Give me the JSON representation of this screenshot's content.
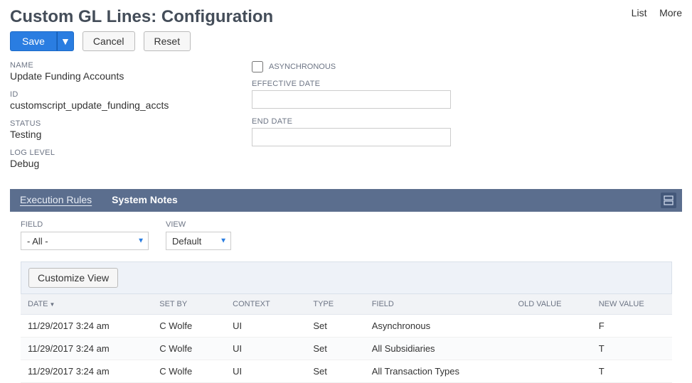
{
  "header": {
    "title": "Custom GL Lines: Configuration",
    "links": {
      "list": "List",
      "more": "More"
    }
  },
  "buttons": {
    "save": "Save",
    "cancel": "Cancel",
    "reset": "Reset",
    "customize_view": "Customize View"
  },
  "fields": {
    "name": {
      "label": "NAME",
      "value": "Update Funding Accounts"
    },
    "id": {
      "label": "ID",
      "value": "customscript_update_funding_accts"
    },
    "status": {
      "label": "STATUS",
      "value": "Testing"
    },
    "loglevel": {
      "label": "LOG LEVEL",
      "value": "Debug"
    },
    "asynchronous": {
      "label": "ASYNCHRONOUS",
      "checked": false
    },
    "effective_date": {
      "label": "EFFECTIVE DATE",
      "value": ""
    },
    "end_date": {
      "label": "END DATE",
      "value": ""
    }
  },
  "tabs": {
    "execution_rules": "Execution Rules",
    "system_notes": "System Notes"
  },
  "filters": {
    "field": {
      "label": "FIELD",
      "value": "- All -"
    },
    "view": {
      "label": "VIEW",
      "value": "Default"
    }
  },
  "table": {
    "columns": {
      "date": "DATE",
      "set_by": "SET BY",
      "context": "CONTEXT",
      "type": "TYPE",
      "field": "FIELD",
      "old_value": "OLD VALUE",
      "new_value": "NEW VALUE"
    },
    "rows": [
      {
        "date": "11/29/2017 3:24 am",
        "set_by": "C Wolfe",
        "context": "UI",
        "type": "Set",
        "field": "Asynchronous",
        "old_value": "",
        "new_value": "F"
      },
      {
        "date": "11/29/2017 3:24 am",
        "set_by": "C Wolfe",
        "context": "UI",
        "type": "Set",
        "field": "All Subsidiaries",
        "old_value": "",
        "new_value": "T"
      },
      {
        "date": "11/29/2017 3:24 am",
        "set_by": "C Wolfe",
        "context": "UI",
        "type": "Set",
        "field": "All Transaction Types",
        "old_value": "",
        "new_value": "T"
      }
    ]
  }
}
